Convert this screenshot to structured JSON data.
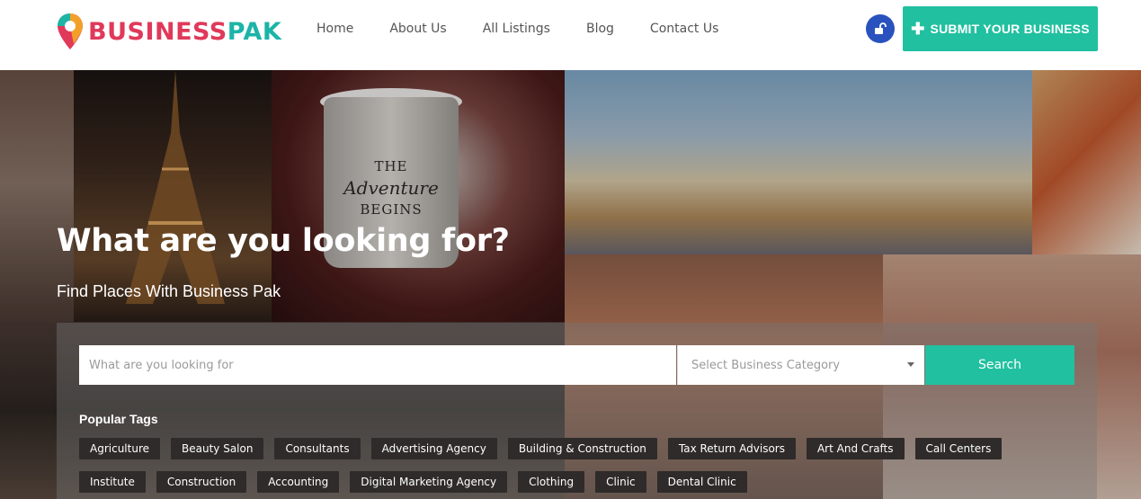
{
  "brand": {
    "name_part1": "BUSINESS",
    "name_part2": "PAK",
    "colors": {
      "pink": "#e0395a",
      "teal": "#1bb5a7",
      "accent_green": "#21c0a0",
      "lock_blue": "#2a52be"
    }
  },
  "nav": {
    "items": [
      {
        "label": "Home"
      },
      {
        "label": "About Us"
      },
      {
        "label": "All Listings"
      },
      {
        "label": "Blog"
      },
      {
        "label": "Contact Us"
      }
    ]
  },
  "header": {
    "lock_icon": "unlock-icon",
    "submit_label": "SUBMIT YOUR BUSINESS",
    "submit_icon": "plus-icon"
  },
  "hero": {
    "title": "What are you looking for?",
    "subtitle": "Find Places With Business Pak"
  },
  "search": {
    "placeholder": "What are you looking for",
    "category_placeholder": "Select Business Category",
    "button_label": "Search"
  },
  "tags": {
    "title": "Popular Tags",
    "items": [
      "Agriculture",
      "Beauty Salon",
      "Consultants",
      "Advertising Agency",
      "Building & Construction",
      "Tax Return Advisors",
      "Art And Crafts",
      "Call Centers",
      "Institute",
      "Construction",
      "Accounting",
      "Digital Marketing Agency",
      "Clothing",
      "Clinic",
      "Dental Clinic"
    ]
  }
}
